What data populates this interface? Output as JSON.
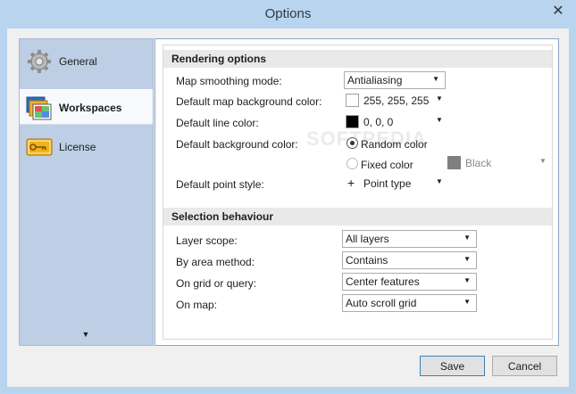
{
  "window": {
    "title": "Options",
    "close_glyph": "✕"
  },
  "sidebar": {
    "items": [
      {
        "label": "General",
        "icon": "gear-icon",
        "active": false
      },
      {
        "label": "Workspaces",
        "icon": "workspaces-icon",
        "active": true
      },
      {
        "label": "License",
        "icon": "license-key-icon",
        "active": false
      }
    ],
    "scroll_glyph": "▼"
  },
  "rendering": {
    "header": "Rendering options",
    "smoothing_label": "Map smoothing mode:",
    "smoothing_value": "Antialiasing",
    "bg_color_label": "Default map background color:",
    "bg_color_value": "255, 255, 255",
    "bg_color_swatch": "#ffffff",
    "line_color_label": "Default line color:",
    "line_color_value": "0, 0, 0",
    "line_color_swatch": "#000000",
    "default_bg_label": "Default background color:",
    "random_color_label": "Random color",
    "random_color_selected": true,
    "fixed_color_label": "Fixed color",
    "fixed_color_selected": false,
    "fixed_color_value": "Black",
    "fixed_color_swatch": "#7f7f7f",
    "point_style_label": "Default point style:",
    "point_style_glyph": "+",
    "point_style_value": "Point type"
  },
  "selection": {
    "header": "Selection behaviour",
    "layer_scope_label": "Layer scope:",
    "layer_scope_value": "All layers",
    "area_method_label": "By area method:",
    "area_method_value": "Contains",
    "grid_query_label": "On grid or query:",
    "grid_query_value": "Center features",
    "on_map_label": "On map:",
    "on_map_value": "Auto scroll grid"
  },
  "buttons": {
    "save": "Save",
    "cancel": "Cancel"
  },
  "watermark": "SOFTPEDIA",
  "dropdown_arrow": "▼"
}
